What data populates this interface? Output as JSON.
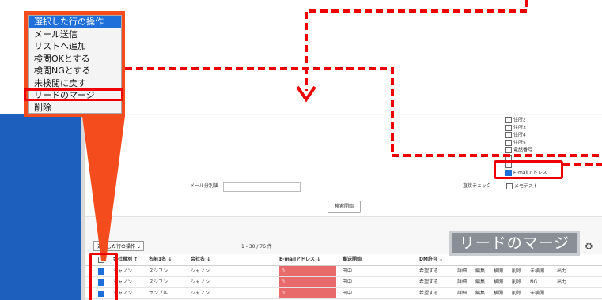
{
  "menu": {
    "items": [
      "選択した行の操作",
      "メール送信",
      "リストへ追加",
      "検閲OKとする",
      "検閲NGとする",
      "未検閲に戻す",
      "リードのマージ",
      "削除"
    ],
    "selected_index": 0,
    "highlighted_index": 6
  },
  "form": {
    "checkbox_options": [
      "住所2",
      "住所3",
      "住所4",
      "住所5",
      "電話番号",
      "",
      "",
      "E-mailアドレス"
    ],
    "checked": [
      false,
      false,
      false,
      false,
      false,
      false,
      false,
      true
    ],
    "mail_label": "メール分別値",
    "direct_check_label": "直接チェック",
    "memo_test_label": "メモテスト",
    "search_button": "検索開始"
  },
  "list": {
    "bulk_action": "選択した行の操作",
    "pagination": "1 - 30 / 76 件",
    "headers": [
      "会社種別 ↑",
      "名前1名 ↓",
      "会社名 ↓",
      "E-mailアドレス ↓",
      "郵送開始",
      "DM許可 ↓"
    ],
    "rows": [
      {
        "type": "シャノン",
        "name": "スシフン",
        "company": "シャノン",
        "email": "0",
        "status": "田中",
        "dm": "希望する",
        "actions": [
          "詳細",
          "編集",
          "検閲",
          "削除",
          "未検閲",
          "出力"
        ]
      },
      {
        "type": "シャノン",
        "name": "スシフン",
        "company": "シャノン",
        "email": "0",
        "status": "田中",
        "dm": "希望する",
        "actions": [
          "詳細",
          "編集",
          "検閲",
          "削除",
          "NG",
          "出力"
        ]
      },
      {
        "type": "シャノン",
        "name": "サンプル",
        "company": "シャノン",
        "email": "0",
        "status": "田中",
        "dm": "希望する",
        "actions": [
          "詳細",
          "編集",
          "検閲",
          "削除",
          "未検閲",
          ""
        ]
      }
    ]
  },
  "callout": {
    "label": "リードのマージ"
  },
  "colors": {
    "accent_red": "#e00000",
    "callout_orange": "#f44c1d",
    "sidebar_blue": "#1c5fbd",
    "selected_blue": "#1e6fd9"
  }
}
